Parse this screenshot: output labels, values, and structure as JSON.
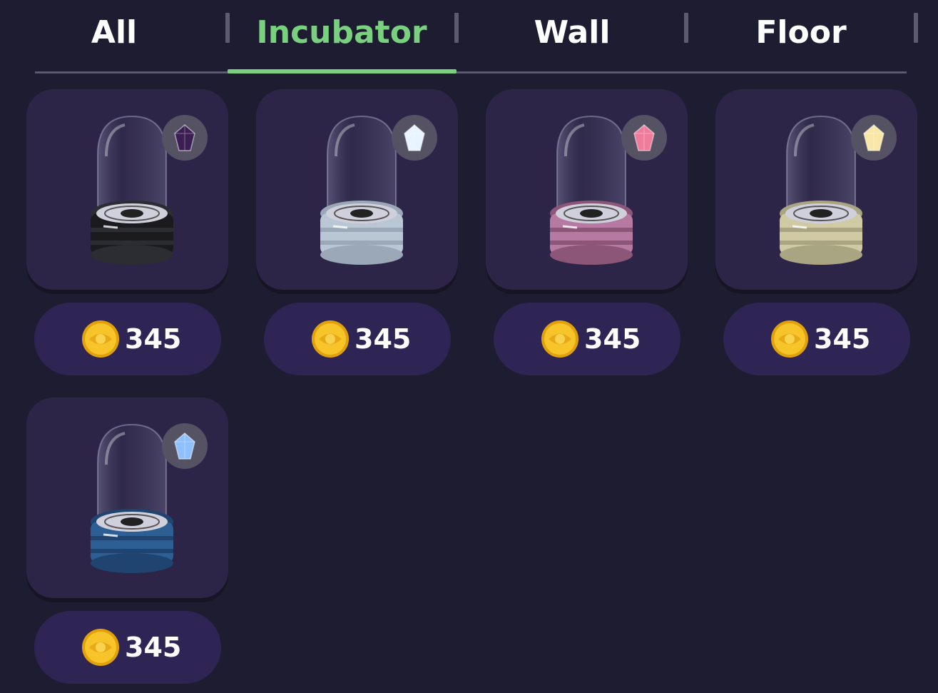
{
  "tabs": [
    {
      "label": "All",
      "active": false
    },
    {
      "label": "Incubator",
      "active": true
    },
    {
      "label": "Wall",
      "active": false
    },
    {
      "label": "Floor",
      "active": false
    }
  ],
  "colors": {
    "background": "#1e1c30",
    "card": "#2d2547",
    "price_pill": "#2f2554",
    "active_tab": "#79d17f",
    "coin": "#f2b614"
  },
  "items": [
    {
      "name": "incubator-dark",
      "base_color": "#1a1a1f",
      "band_color": "#2c2c33",
      "gem": "dark-purple-crystal",
      "gem_color": "#3b1f52",
      "price": "345",
      "currency_icon": "gold-coin"
    },
    {
      "name": "incubator-silver",
      "base_color": "#b9c6d4",
      "band_color": "#9aa8b8",
      "gem": "white-crystal",
      "gem_color": "#e8f4ff",
      "price": "345",
      "currency_icon": "gold-coin"
    },
    {
      "name": "incubator-pink",
      "base_color": "#b67aa2",
      "band_color": "#8c5678",
      "gem": "pink-crystal",
      "gem_color": "#f07b9a",
      "price": "345",
      "currency_icon": "gold-coin"
    },
    {
      "name": "incubator-cream",
      "base_color": "#cfcaa3",
      "band_color": "#a9a582",
      "gem": "yellow-crystal",
      "gem_color": "#f8e7a6",
      "price": "345",
      "currency_icon": "gold-coin"
    },
    {
      "name": "incubator-blue",
      "base_color": "#2d5e94",
      "band_color": "#1f4470",
      "gem": "blue-crystal",
      "gem_color": "#8fbfff",
      "price": "345",
      "currency_icon": "gold-coin"
    }
  ]
}
